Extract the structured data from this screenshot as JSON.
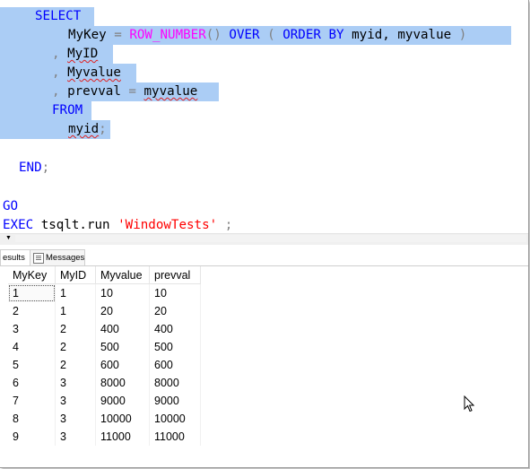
{
  "editor": {
    "line1": {
      "kw": "SELECT"
    },
    "line2": {
      "col": "MyKey",
      "eq": " = ",
      "fn": "ROW_NUMBER",
      "paren": "()",
      "over": "OVER",
      "lp": "(",
      "orderby": "ORDER BY",
      "args": "myid, myvalue",
      "rp": ")"
    },
    "line3": {
      "comma": ",",
      "col": "MyID"
    },
    "line4": {
      "comma": ",",
      "col": "Myvalue"
    },
    "line5": {
      "comma": ",",
      "col": "prevval",
      "eq": " = ",
      "rhs": "myvalue"
    },
    "line6": {
      "kw": "FROM"
    },
    "line7": {
      "tbl": "myid",
      "semi": ";"
    },
    "line8": {
      "kw": "END",
      "semi": ";"
    },
    "line9": {
      "kw": "GO"
    },
    "line10": {
      "kw": "EXEC",
      "obj": "tsqlt.run",
      "str": "'WindowTests'",
      "semi": ";"
    }
  },
  "tabs": {
    "results": "esults",
    "messages": "Messages"
  },
  "grid": {
    "columns": [
      "MyKey",
      "MyID",
      "Myvalue",
      "prevval"
    ],
    "rows": [
      [
        "1",
        "1",
        "10",
        "10"
      ],
      [
        "2",
        "1",
        "20",
        "20"
      ],
      [
        "3",
        "2",
        "400",
        "400"
      ],
      [
        "4",
        "2",
        "500",
        "500"
      ],
      [
        "5",
        "2",
        "600",
        "600"
      ],
      [
        "6",
        "3",
        "8000",
        "8000"
      ],
      [
        "7",
        "3",
        "9000",
        "9000"
      ],
      [
        "8",
        "3",
        "10000",
        "10000"
      ],
      [
        "9",
        "3",
        "11000",
        "11000"
      ]
    ]
  },
  "colors": {
    "selection": "#abcdf5",
    "keyword": "#0000ff",
    "function": "#ff00ff",
    "string": "#ff0000",
    "operator": "#808080"
  }
}
